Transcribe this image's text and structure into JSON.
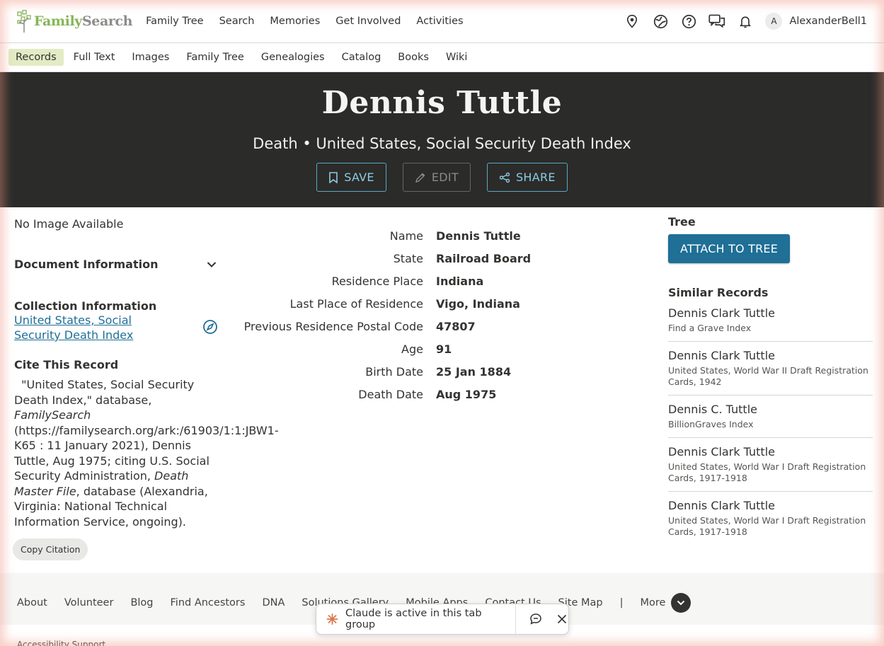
{
  "header": {
    "logo_family": "Family",
    "logo_search": "Search",
    "nav": [
      "Family Tree",
      "Search",
      "Memories",
      "Get Involved",
      "Activities"
    ],
    "avatar_letter": "A",
    "username": "AlexanderBell1",
    "icons": [
      "location-pin-icon",
      "globe-icon",
      "help-icon",
      "chat-icon",
      "bell-icon"
    ]
  },
  "subnav": {
    "items": [
      "Records",
      "Full Text",
      "Images",
      "Family Tree",
      "Genealogies",
      "Catalog",
      "Books",
      "Wiki"
    ],
    "active": "Records"
  },
  "hero": {
    "title": "Dennis Tuttle",
    "subtitle": "Death • United States, Social Security Death Index",
    "save_label": "SAVE",
    "edit_label": "EDIT",
    "share_label": "SHARE"
  },
  "left": {
    "no_image": "No Image Available",
    "doc_info": "Document Information",
    "collection_title": "Collection Information",
    "collection_link": "United States, Social Security Death Index",
    "cite_title": "Cite This Record",
    "cite_p1": "\"United States, Social Security Death Index,\" database, ",
    "cite_fs": "FamilySearch",
    "cite_p2": " (https://familysearch.org/ark:/61903/1:1:JBW1-K65 : 11 January 2021), Dennis Tuttle, Aug 1975; citing U.S. Social Security Administration, ",
    "cite_dmf": "Death Master File",
    "cite_p3": ", database (Alexandria, Virginia: National Technical Information Service, ongoing).",
    "copy_label": "Copy Citation"
  },
  "facts": [
    {
      "label": "Name",
      "value": "Dennis Tuttle"
    },
    {
      "label": "State",
      "value": "Railroad Board"
    },
    {
      "label": "Residence Place",
      "value": "Indiana"
    },
    {
      "label": "Last Place of Residence",
      "value": "Vigo, Indiana"
    },
    {
      "label": "Previous Residence Postal Code",
      "value": "47807"
    },
    {
      "label": "Age",
      "value": "91"
    },
    {
      "label": "Birth Date",
      "value": "25 Jan 1884"
    },
    {
      "label": "Death Date",
      "value": "Aug 1975"
    }
  ],
  "right": {
    "tree_title": "Tree",
    "attach_label": "ATTACH TO TREE",
    "similar_title": "Similar Records",
    "similar": [
      {
        "name": "Dennis Clark Tuttle",
        "collection": "Find a Grave Index"
      },
      {
        "name": "Dennis Clark Tuttle",
        "collection": "United States, World War II Draft Registration Cards, 1942"
      },
      {
        "name": "Dennis C. Tuttle",
        "collection": "BillionGraves Index"
      },
      {
        "name": "Dennis Clark Tuttle",
        "collection": "United States, World War I Draft Registration Cards, 1917-1918"
      },
      {
        "name": "Dennis Clark Tuttle",
        "collection": "United States, World War I Draft Registration Cards, 1917-1918"
      }
    ]
  },
  "footer": {
    "items": [
      "About",
      "Volunteer",
      "Blog",
      "Find Ancestors",
      "DNA",
      "Solutions Gallery",
      "Mobile Apps",
      "Contact Us",
      "Site Map"
    ],
    "separator": "|",
    "more_label": "More",
    "bottom_link": "Accessibility Support"
  },
  "toast": {
    "text": "Claude is active in this tab group"
  },
  "colors": {
    "brand_green": "#87b556",
    "link_blue": "#1f6f96",
    "hero_bg": "#2b2b29",
    "active_tab_bg": "#e2ebc4"
  }
}
